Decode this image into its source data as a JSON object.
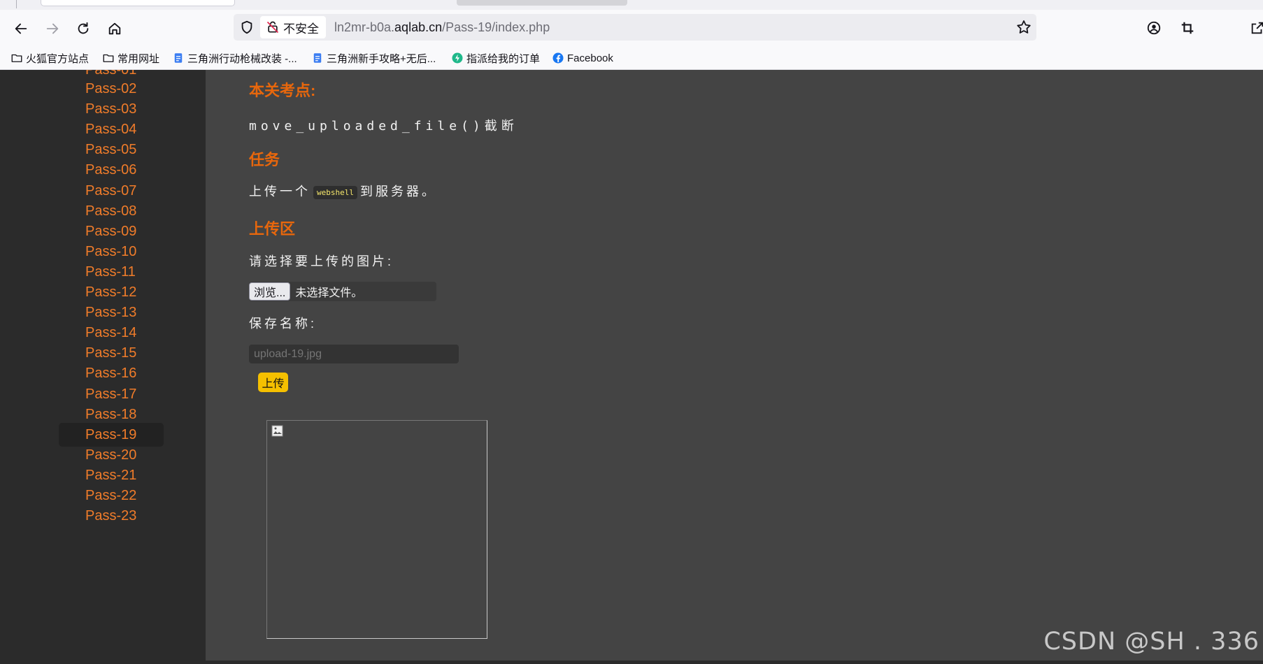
{
  "browser": {
    "security_label": "不安全",
    "url_prefix": "ln2mr-b0a.",
    "url_host": "aqlab.cn",
    "url_path": "/Pass-19/index.php"
  },
  "bookmarks": [
    {
      "label": "火狐官方站点",
      "icon": "folder-icon"
    },
    {
      "label": "常用网址",
      "icon": "folder-icon"
    },
    {
      "label": "三角洲行动枪械改装 -...",
      "icon": "doc-icon"
    },
    {
      "label": "三角洲新手攻略+无后...",
      "icon": "doc-icon"
    },
    {
      "label": "指派给我的订单",
      "icon": "bolt-icon"
    },
    {
      "label": "Facebook",
      "icon": "facebook-icon"
    }
  ],
  "sidebar": {
    "partial_item": "Pass-01",
    "items": [
      "Pass-02",
      "Pass-03",
      "Pass-04",
      "Pass-05",
      "Pass-06",
      "Pass-07",
      "Pass-08",
      "Pass-09",
      "Pass-10",
      "Pass-11",
      "Pass-12",
      "Pass-13",
      "Pass-14",
      "Pass-15",
      "Pass-16",
      "Pass-17",
      "Pass-18",
      "Pass-19",
      "Pass-20",
      "Pass-21",
      "Pass-22",
      "Pass-23"
    ],
    "active": "Pass-19"
  },
  "main": {
    "key_point_heading": "本关考点:",
    "key_point_text": "move_uploaded_file()截断",
    "task_heading": "任务",
    "task_before": "上传一个",
    "task_code": "webshell",
    "task_after": "到服务器。",
    "upload_heading": "上传区",
    "select_prompt": "请选择要上传的图片:",
    "browse_label": "浏览...",
    "file_status": "未选择文件。",
    "save_name_label": "保存名称:",
    "save_name_placeholder": "upload-19.jpg",
    "upload_button": "上传"
  },
  "watermark": "CSDN @SH . 336",
  "colors": {
    "accent_orange": "#e8670c",
    "sidebar_link": "#f07c2a",
    "upload_button": "#f5c000"
  }
}
